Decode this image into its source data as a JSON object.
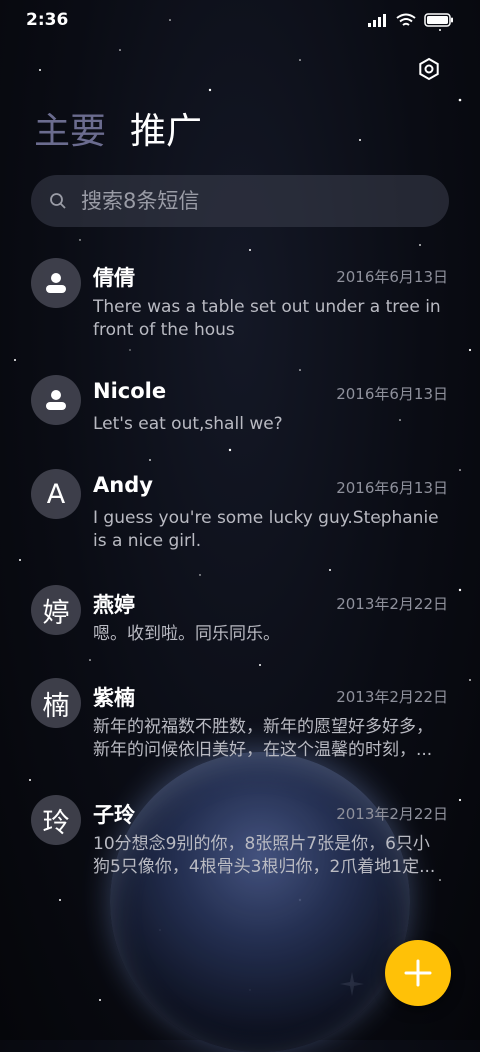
{
  "status_bar": {
    "time": "2:36"
  },
  "tabs": [
    {
      "label": "主要"
    },
    {
      "label": "推广"
    }
  ],
  "search": {
    "placeholder": "搜索8条短信"
  },
  "messages": [
    {
      "avatar": "",
      "avatar_icon": "person-icon",
      "name": "倩倩",
      "date": "2016年6月13日",
      "preview": "There was a table set out under a tree in front of the hous"
    },
    {
      "avatar": "",
      "avatar_icon": "person-icon",
      "name": "Nicole",
      "date": "2016年6月13日",
      "preview": "Let's eat out,shall we?"
    },
    {
      "avatar": "A",
      "name": "Andy",
      "date": "2016年6月13日",
      "preview": "I guess you're some lucky guy.Stephanie is a nice girl."
    },
    {
      "avatar": "婷",
      "name": "燕婷",
      "date": "2013年2月22日",
      "preview": "嗯。收到啦。同乐同乐。"
    },
    {
      "avatar": "楠",
      "name": "紫楠",
      "date": "2013年2月22日",
      "preview": "新年的祝福数不胜数，新年的愿望好多好多，新年的问候依旧美好，在这个温馨的时刻，..."
    },
    {
      "avatar": "玲",
      "name": "子玲",
      "date": "2013年2月22日",
      "preview": "10分想念9别的你，8张照片7张是你，6只小狗5只像你，4根骨头3根归你，2爪着地1定..."
    }
  ],
  "fab": {
    "icon": "plus-icon"
  },
  "colors": {
    "accent": "#ffc107",
    "tab_inactive": "#6b6c8f",
    "background": "#0a0c14"
  }
}
